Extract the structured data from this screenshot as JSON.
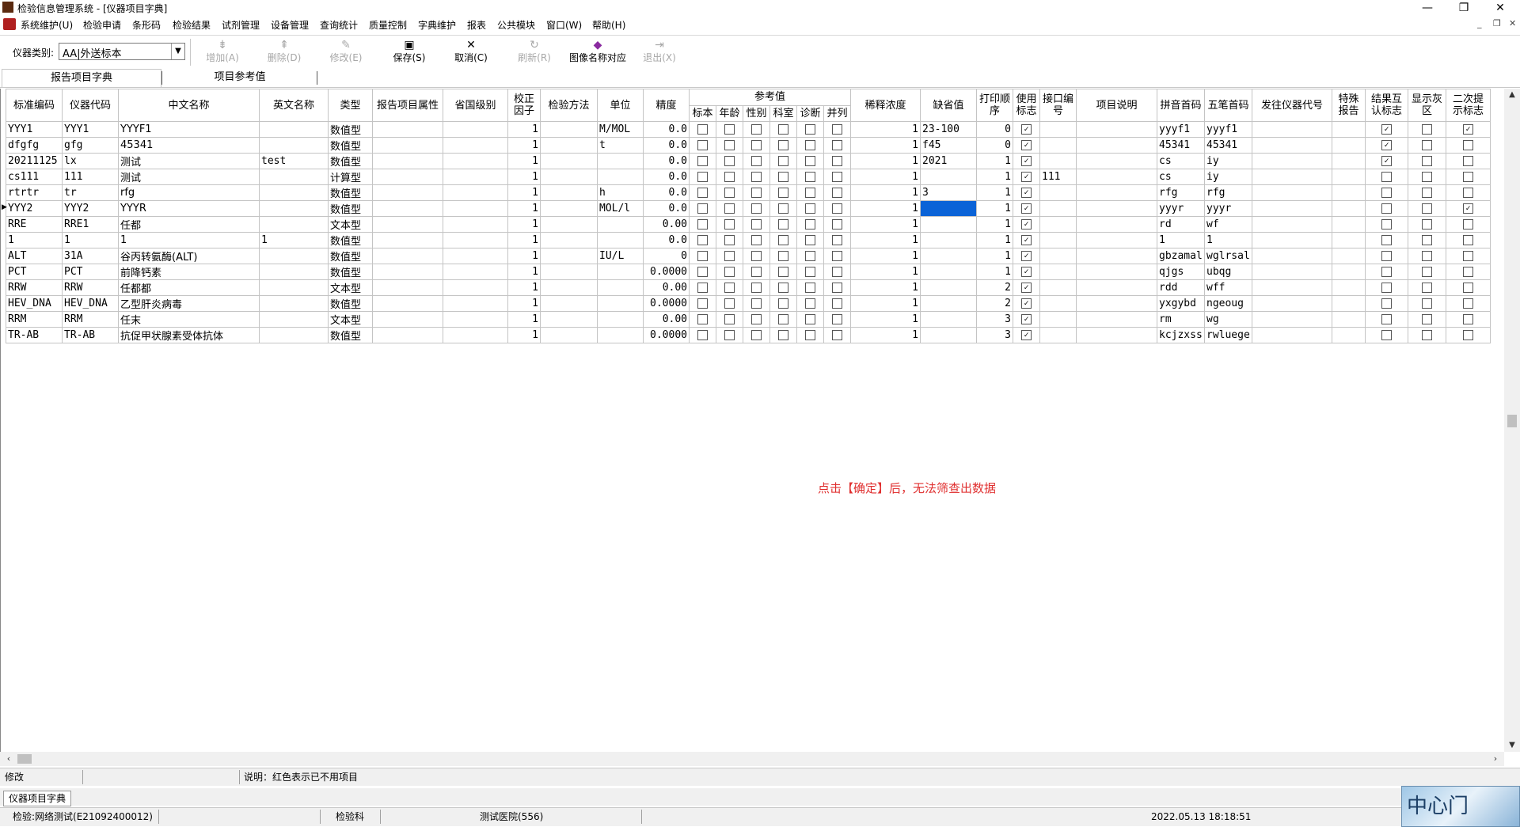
{
  "window": {
    "title": "检验信息管理系统 - [仪器项目字典]",
    "minimize": "—",
    "restore": "❐",
    "close": "✕"
  },
  "menu": [
    "系统维护(U)",
    "检验申请",
    "条形码",
    "检验结果",
    "试剂管理",
    "设备管理",
    "查询统计",
    "质量控制",
    "字典维护",
    "报表",
    "公共模块",
    "窗口(W)",
    "帮助(H)"
  ],
  "mdi": {
    "minimize": "_",
    "restore": "❐",
    "close": "✕"
  },
  "toolbar": {
    "category_label": "仪器类别:",
    "category_value": "AA|外送标本",
    "buttons": [
      {
        "label": "增加(A)",
        "icon": "add-row-icon",
        "enabled": false
      },
      {
        "label": "删除(D)",
        "icon": "delete-row-icon",
        "enabled": false
      },
      {
        "label": "修改(E)",
        "icon": "edit-icon",
        "enabled": false
      },
      {
        "label": "保存(S)",
        "icon": "save-disk-icon",
        "enabled": true
      },
      {
        "label": "取消(C)",
        "icon": "cancel-x-icon",
        "enabled": true
      },
      {
        "label": "刷新(R)",
        "icon": "refresh-icon",
        "enabled": false
      },
      {
        "label": "图像名称对应",
        "icon": "book-icon",
        "enabled": true
      },
      {
        "label": "退出(X)",
        "icon": "exit-icon",
        "enabled": false
      }
    ]
  },
  "tabs": [
    "报告项目字典",
    "项目参考值"
  ],
  "table": {
    "columns": [
      "标准编码",
      "仪器代码",
      "中文名称",
      "英文名称",
      "类型",
      "报告项目属性",
      "省国级别",
      "校正因子",
      "检验方法",
      "单位",
      "精度",
      "参考值",
      "稀释浓度",
      "缺省值",
      "打印顺序",
      "使用标志",
      "接口编号",
      "项目说明",
      "拼音首码",
      "五笔首码",
      "发往仪器代号",
      "特殊报告",
      "结果互认标志",
      "显示灰区",
      "二次提示标志"
    ],
    "ref_subcolumns": [
      "标本",
      "年龄",
      "性别",
      "科室",
      "诊断",
      "并列"
    ],
    "rows": [
      {
        "std": "YYY1",
        "code": "YYY1",
        "cn": "YYYF1",
        "en": "",
        "type": "数值型",
        "factor": "1",
        "unit": "M/MOL",
        "prec": "0.0",
        "dil": "1",
        "def": "23-100",
        "order": "0",
        "use": true,
        "iface": "",
        "py": "yyyf1",
        "wb": "yyyf1",
        "mutual": true,
        "gray": false,
        "second": true
      },
      {
        "std": "dfgfg",
        "code": "gfg",
        "cn": "45341",
        "en": "",
        "type": "数值型",
        "factor": "1",
        "unit": "t",
        "prec": "0.0",
        "dil": "1",
        "def": "f45",
        "order": "0",
        "use": true,
        "iface": "",
        "py": "45341",
        "wb": "45341",
        "mutual": true,
        "gray": false,
        "second": false
      },
      {
        "std": "20211125",
        "code": "lx",
        "cn": "测试",
        "en": "test",
        "type": "数值型",
        "factor": "1",
        "unit": "",
        "prec": "0.0",
        "dil": "1",
        "def": "2021",
        "order": "1",
        "use": true,
        "iface": "",
        "py": "cs",
        "wb": "iy",
        "mutual": true,
        "gray": false,
        "second": false
      },
      {
        "std": "cs111",
        "code": "111",
        "cn": "测试",
        "en": "",
        "type": "计算型",
        "factor": "1",
        "unit": "",
        "prec": "0.0",
        "dil": "1",
        "def": "",
        "order": "1",
        "use": true,
        "iface": "111",
        "py": "cs",
        "wb": "iy",
        "mutual": false,
        "gray": false,
        "second": false
      },
      {
        "std": "rtrtr",
        "code": "tr",
        "cn": "rfg",
        "en": "",
        "type": "数值型",
        "factor": "1",
        "unit": "h",
        "prec": "0.0",
        "dil": "1",
        "def": "3",
        "order": "1",
        "use": true,
        "iface": "",
        "py": "rfg",
        "wb": "rfg",
        "mutual": false,
        "gray": false,
        "second": false
      },
      {
        "std": "YYY2",
        "code": "YYY2",
        "cn": "YYYR",
        "en": "",
        "type": "数值型",
        "factor": "1",
        "unit": "MOL/l",
        "prec": "0.0",
        "dil": "1",
        "def": "",
        "order": "1",
        "use": true,
        "iface": "",
        "py": "yyyr",
        "wb": "yyyr",
        "mutual": false,
        "gray": false,
        "second": true
      },
      {
        "std": "RRE",
        "code": "RRE1",
        "cn": "任都",
        "en": "",
        "type": "文本型",
        "factor": "1",
        "unit": "",
        "prec": "0.00",
        "dil": "1",
        "def": "",
        "order": "1",
        "use": true,
        "iface": "",
        "py": "rd",
        "wb": "wf",
        "mutual": false,
        "gray": false,
        "second": false
      },
      {
        "std": "1",
        "code": "1",
        "cn": "1",
        "en": "1",
        "type": "数值型",
        "factor": "1",
        "unit": "",
        "prec": "0.0",
        "dil": "1",
        "def": "",
        "order": "1",
        "use": true,
        "iface": "",
        "py": "1",
        "wb": "1",
        "mutual": false,
        "gray": false,
        "second": false
      },
      {
        "std": "ALT",
        "code": "31A",
        "cn": "谷丙转氨酶(ALT)",
        "en": "",
        "type": "数值型",
        "factor": "1",
        "unit": "IU/L",
        "prec": "0",
        "dil": "1",
        "def": "",
        "order": "1",
        "use": true,
        "iface": "",
        "py": "gbzamal",
        "wb": "wglrsal",
        "mutual": false,
        "gray": false,
        "second": false
      },
      {
        "std": "PCT",
        "code": "PCT",
        "cn": "前降钙素",
        "en": "",
        "type": "数值型",
        "factor": "1",
        "unit": "",
        "prec": "0.0000",
        "dil": "1",
        "def": "",
        "order": "1",
        "use": true,
        "iface": "",
        "py": "qjgs",
        "wb": "ubqg",
        "mutual": false,
        "gray": false,
        "second": false
      },
      {
        "std": "RRW",
        "code": "RRW",
        "cn": "任都都",
        "en": "",
        "type": "文本型",
        "factor": "1",
        "unit": "",
        "prec": "0.00",
        "dil": "1",
        "def": "",
        "order": "2",
        "use": true,
        "iface": "",
        "py": "rdd",
        "wb": "wff",
        "mutual": false,
        "gray": false,
        "second": false
      },
      {
        "std": "HEV_DNA",
        "code": "HEV_DNA",
        "cn": "乙型肝炎病毒",
        "en": "",
        "type": "数值型",
        "factor": "1",
        "unit": "",
        "prec": "0.0000",
        "dil": "1",
        "def": "",
        "order": "2",
        "use": true,
        "iface": "",
        "py": "yxgybd",
        "wb": "ngeoug",
        "mutual": false,
        "gray": false,
        "second": false
      },
      {
        "std": "RRM",
        "code": "RRM",
        "cn": "任末",
        "en": "",
        "type": "文本型",
        "factor": "1",
        "unit": "",
        "prec": "0.00",
        "dil": "1",
        "def": "",
        "order": "3",
        "use": true,
        "iface": "",
        "py": "rm",
        "wb": "wg",
        "mutual": false,
        "gray": false,
        "second": false
      },
      {
        "std": "TR-AB",
        "code": "TR-AB",
        "cn": "抗促甲状腺素受体抗体",
        "en": "",
        "type": "数值型",
        "factor": "1",
        "unit": "",
        "prec": "0.0000",
        "dil": "1",
        "def": "",
        "order": "3",
        "use": true,
        "iface": "",
        "py": "kcjzxss",
        "wb": "rwluege",
        "mutual": false,
        "gray": false,
        "second": false
      }
    ],
    "current_row": 5,
    "selected_col": "def"
  },
  "annotation": "点击【确定】后，无法筛查出数据",
  "status1": {
    "mode": "修改",
    "blank": "",
    "note": "说明：红色表示已不用项目"
  },
  "taskbar": {
    "tab": "仪器项目字典"
  },
  "status2": {
    "user": "检验:网络测试(E21092400012)",
    "dept": "检验科",
    "hospital": "测试医院(556)",
    "datetime": "2022.05.13 18:18:51"
  },
  "logo_text": "中心门"
}
